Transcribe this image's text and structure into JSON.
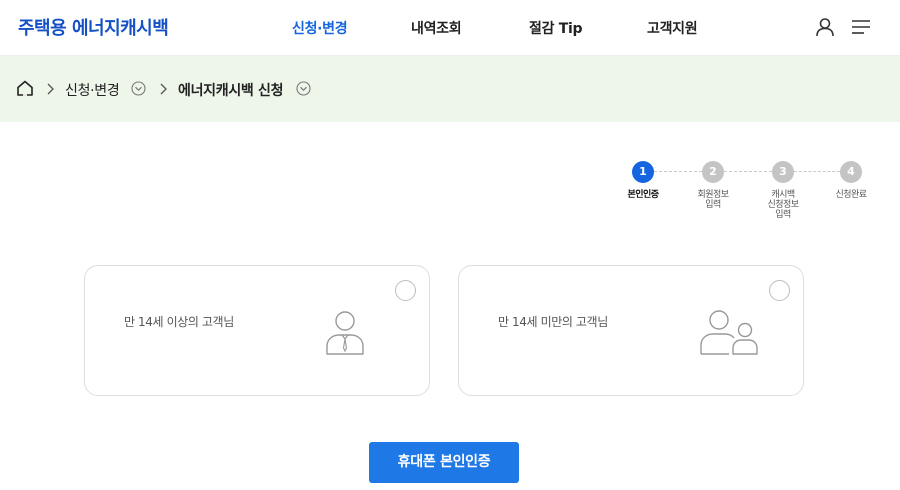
{
  "header": {
    "logo": "주택용 에너지캐시백",
    "nav": [
      {
        "label": "신청·변경",
        "active": true
      },
      {
        "label": "내역조회",
        "active": false
      },
      {
        "label": "절감 Tip",
        "active": false
      },
      {
        "label": "고객지원",
        "active": false
      }
    ],
    "icons": [
      "user-icon",
      "menu-icon"
    ]
  },
  "breadcrumb": {
    "home_icon": "home-icon",
    "items": [
      "신청·변경",
      "에너지캐시백 신청"
    ]
  },
  "steps": [
    {
      "number": "1",
      "label": "본인인증",
      "active": true
    },
    {
      "number": "2",
      "label": "회원정보\n입력",
      "active": false
    },
    {
      "number": "3",
      "label": "캐시백\n신청정보\n입력",
      "active": false
    },
    {
      "number": "4",
      "label": "신청완료",
      "active": false
    }
  ],
  "options": [
    {
      "text": "만 14세 이상의 고객님",
      "icon": "adult-person-icon",
      "selected": false
    },
    {
      "text": "만 14세 미만의 고객님",
      "icon": "guardian-child-icon",
      "selected": false
    }
  ],
  "verify_button": "휴대폰 본인인증",
  "colors": {
    "brand": "#1550c4",
    "accent": "#1565e0",
    "button": "#1e78e6",
    "breadcrumb_bg": "#eef5e9",
    "step_inactive": "#c4c4c4"
  }
}
